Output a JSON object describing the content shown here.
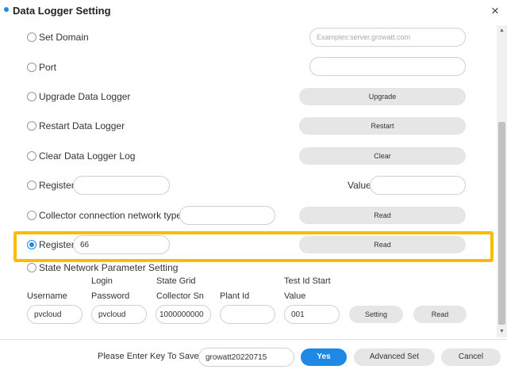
{
  "window": {
    "title": "Data Logger Setting",
    "close_glyph": "×",
    "accent": "#1e88e5",
    "highlight_color": "#f7bd00"
  },
  "rows": {
    "set_domain": {
      "label": "Set Domain",
      "placeholder": "Examples:server.growatt.com"
    },
    "port": {
      "label": "Port",
      "value": ""
    },
    "upgrade": {
      "label": "Upgrade Data Logger",
      "button": "Upgrade"
    },
    "restart": {
      "label": "Restart Data Logger",
      "button": "Restart"
    },
    "clear": {
      "label": "Clear Data Logger Log",
      "button": "Clear"
    },
    "register_set": {
      "label": "Register",
      "value_label": "Value",
      "register_value": "",
      "value_value": ""
    },
    "collector_network": {
      "label": "Collector connection network type",
      "value": "",
      "button": "Read"
    },
    "register_read": {
      "label": "Register",
      "value": "66",
      "button": "Read",
      "selected": true
    },
    "state_network": {
      "label": "State Network Parameter Setting",
      "username_label": "Username",
      "login_password_label_1": "Login",
      "login_password_label_2": "Password",
      "collector_sn_label_1": "State Grid",
      "collector_sn_label_2": "Collector Sn",
      "plant_id_label": "Plant Id",
      "test_id_label_1": "Test Id Start",
      "test_id_label_2": "Value",
      "username_value": "pvcloud",
      "password_value": "pvcloud",
      "collector_sn_value": "1000000000",
      "plant_id_value": "",
      "test_id_value": "001",
      "setting_button": "Setting",
      "read_button": "Read"
    }
  },
  "footer": {
    "prompt": "Please Enter Key To Save",
    "key_value": "growatt20220715",
    "yes_button": "Yes",
    "advanced_button": "Advanced Set",
    "cancel_button": "Cancel"
  },
  "scrollbar": {
    "up_glyph": "▲",
    "down_glyph": "▼"
  }
}
